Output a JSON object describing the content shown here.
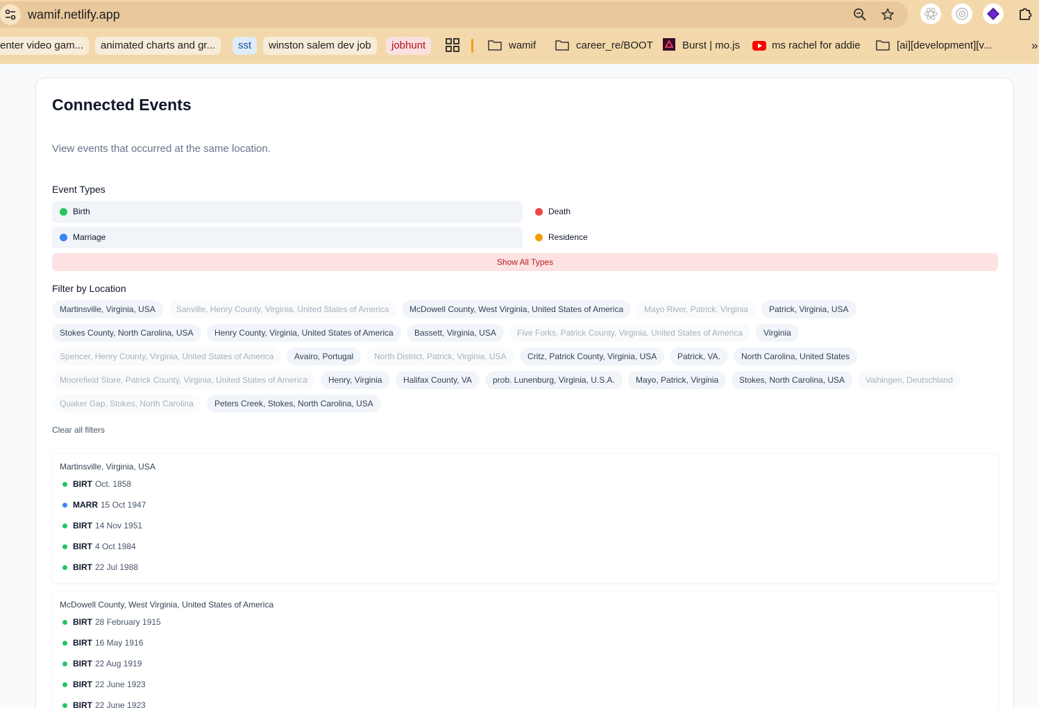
{
  "browser": {
    "url": "wamif.netlify.app",
    "bookmarks": [
      {
        "label": "enter video gam...",
        "style": "pill"
      },
      {
        "label": "animated charts and gr...",
        "style": "pill"
      },
      {
        "label": "sst",
        "style": "pill-blue"
      },
      {
        "label": "winston salem dev job",
        "style": "pill"
      },
      {
        "label": "jobhunt",
        "style": "pill-red"
      },
      {
        "label": "wamif",
        "style": "folder"
      },
      {
        "label": "career_re/BOOT",
        "style": "folder"
      },
      {
        "label": "Burst | mo.js",
        "style": "site"
      },
      {
        "label": "ms rachel for addie",
        "style": "youtube"
      },
      {
        "label": "[ai][development][v...",
        "style": "folder"
      }
    ],
    "more_bookmarks": "»"
  },
  "page": {
    "title": "Connected Events",
    "subtitle": "View events that occurred at the same location.",
    "event_types_label": "Event Types",
    "event_types": [
      {
        "label": "Birth",
        "color": "#22c55e",
        "active": true
      },
      {
        "label": "Death",
        "color": "#ef4444",
        "active": false
      },
      {
        "label": "Marriage",
        "color": "#3b82f6",
        "active": true
      },
      {
        "label": "Residence",
        "color": "#f59e0b",
        "active": false
      }
    ],
    "show_all_label": "Show All Types",
    "filter_location_label": "Filter by Location",
    "locations": [
      {
        "label": "Martinsville, Virginia, USA",
        "active": true
      },
      {
        "label": "Sanville, Henry County, Virginia, United States of America",
        "active": false
      },
      {
        "label": "McDowell County, West Virginia, United States of America",
        "active": true
      },
      {
        "label": "Mayo River, Patrick, Virginia",
        "active": false
      },
      {
        "label": "Patrick, Virginia, USA",
        "active": true
      },
      {
        "label": "Stokes County, North Carolina, USA",
        "active": true
      },
      {
        "label": "Henry County, Virginia, United States of America",
        "active": true
      },
      {
        "label": "Bassett, Virginia, USA",
        "active": true
      },
      {
        "label": "Five Forks, Patrick County, Virginia, United States of America",
        "active": false
      },
      {
        "label": "Virginia",
        "active": true
      },
      {
        "label": "Spencer, Henry County, Virginia, United States of America",
        "active": false
      },
      {
        "label": "Avairo, Portugal",
        "active": true
      },
      {
        "label": "North District, Patrick, Virginia, USA",
        "active": false
      },
      {
        "label": "Critz, Patrick County, Virginia, USA",
        "active": true
      },
      {
        "label": "Patrick, VA.",
        "active": true
      },
      {
        "label": "North Carolina, United States",
        "active": true
      },
      {
        "label": "Moorefield Store, Patrick County, Virginia, United States of America",
        "active": false
      },
      {
        "label": "Henry, Virginia",
        "active": true
      },
      {
        "label": "Halifax County, VA",
        "active": true
      },
      {
        "label": "prob. Lunenburg, Virginia, U.S.A.",
        "active": true
      },
      {
        "label": "Mayo, Patrick, Virginia",
        "active": true
      },
      {
        "label": "Stokes, North Carolina, USA",
        "active": true
      },
      {
        "label": "Vaihingen, Deutschland",
        "active": false
      },
      {
        "label": "Quaker Gap, Stokes, North Carolina",
        "active": false
      },
      {
        "label": "Peters Creek, Stokes, North Carolina, USA",
        "active": true
      }
    ],
    "clear_filters_label": "Clear all filters",
    "groups": [
      {
        "location": "Martinsville, Virginia, USA",
        "events": [
          {
            "code": "BIRT",
            "date": "Oct. 1858",
            "color": "#22c55e"
          },
          {
            "code": "MARR",
            "date": "15 Oct 1947",
            "color": "#3b82f6"
          },
          {
            "code": "BIRT",
            "date": "14 Nov 1951",
            "color": "#22c55e"
          },
          {
            "code": "BIRT",
            "date": "4 Oct 1984",
            "color": "#22c55e"
          },
          {
            "code": "BIRT",
            "date": "22 Jul 1988",
            "color": "#22c55e"
          }
        ]
      },
      {
        "location": "McDowell County, West Virginia, United States of America",
        "events": [
          {
            "code": "BIRT",
            "date": "28 February 1915",
            "color": "#22c55e"
          },
          {
            "code": "BIRT",
            "date": "16 May 1916",
            "color": "#22c55e"
          },
          {
            "code": "BIRT",
            "date": "22 Aug 1919",
            "color": "#22c55e"
          },
          {
            "code": "BIRT",
            "date": "22 June 1923",
            "color": "#22c55e"
          },
          {
            "code": "BIRT",
            "date": "22 June 1923",
            "color": "#22c55e"
          }
        ]
      }
    ]
  }
}
